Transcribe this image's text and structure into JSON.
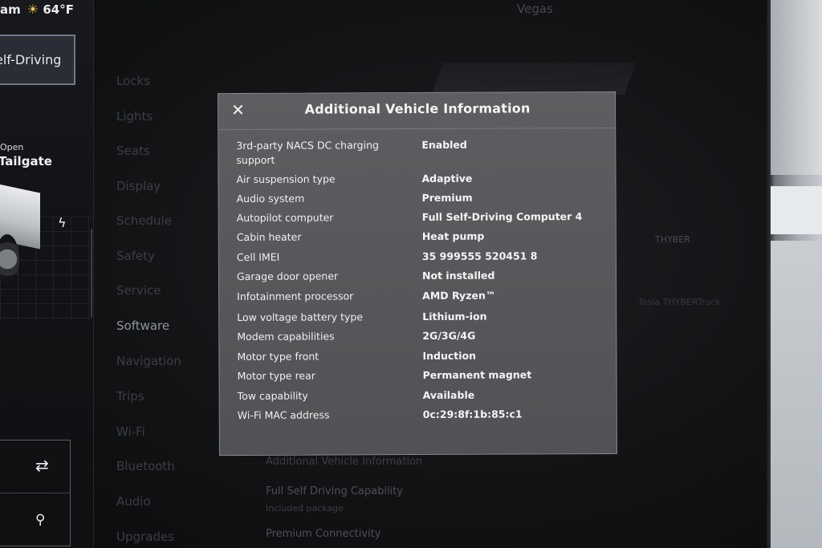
{
  "status_bar": {
    "time_suffix": "am",
    "temperature": "64°F",
    "weather_icon": "sun-icon"
  },
  "left_panel": {
    "fsd_button_label": "elf-Driving",
    "trunk_state": "Open",
    "trunk_label": "Tailgate",
    "charge_icon": "bolt-icon",
    "repeat_icon": "repeat-icon",
    "search_icon": "search-icon"
  },
  "background": {
    "location": "Vegas",
    "menu": [
      "Locks",
      "Lights",
      "Seats",
      "Display",
      "Schedule",
      "Safety",
      "Service",
      "Software",
      "Navigation",
      "Trips",
      "Wi-Fi",
      "Bluetooth",
      "Audio",
      "Upgrades"
    ],
    "active_menu": "Software",
    "software_links": {
      "additional_info": "Additional Vehicle Information",
      "fsd_capability": "Full Self Driving Capability",
      "fsd_included": "Included package",
      "premium_connectivity": "Premium Connectivity"
    },
    "right_label": "THYBER",
    "right_label2": "Tesla THYBERTruck"
  },
  "modal": {
    "title": "Additional Vehicle Information",
    "close_icon": "close-icon",
    "rows": [
      {
        "key": "3rd-party NACS DC charging support",
        "value": "Enabled"
      },
      {
        "key": "Air suspension type",
        "value": "Adaptive"
      },
      {
        "key": "Audio system",
        "value": "Premium"
      },
      {
        "key": "Autopilot computer",
        "value": "Full Self-Driving Computer 4"
      },
      {
        "key": "Cabin heater",
        "value": "Heat pump"
      },
      {
        "key": "Cell IMEI",
        "value": "35 999555 520451 8"
      },
      {
        "key": "Garage door opener",
        "value": "Not installed"
      },
      {
        "key": "Infotainment processor",
        "value": "AMD Ryzen™"
      },
      {
        "key": "Low voltage battery type",
        "value": "Lithium-ion"
      },
      {
        "key": "Modem capabilities",
        "value": "2G/3G/4G"
      },
      {
        "key": "Motor type front",
        "value": "Induction"
      },
      {
        "key": "Motor type rear",
        "value": "Permanent magnet"
      },
      {
        "key": "Tow capability",
        "value": "Available"
      },
      {
        "key": "Wi-Fi MAC address",
        "value": "0c:29:8f:1b:85:c1"
      }
    ]
  },
  "colors": {
    "modal_bg": "#58595c",
    "text": "#f3f4f6",
    "accent_sun": "#f2c94c"
  }
}
